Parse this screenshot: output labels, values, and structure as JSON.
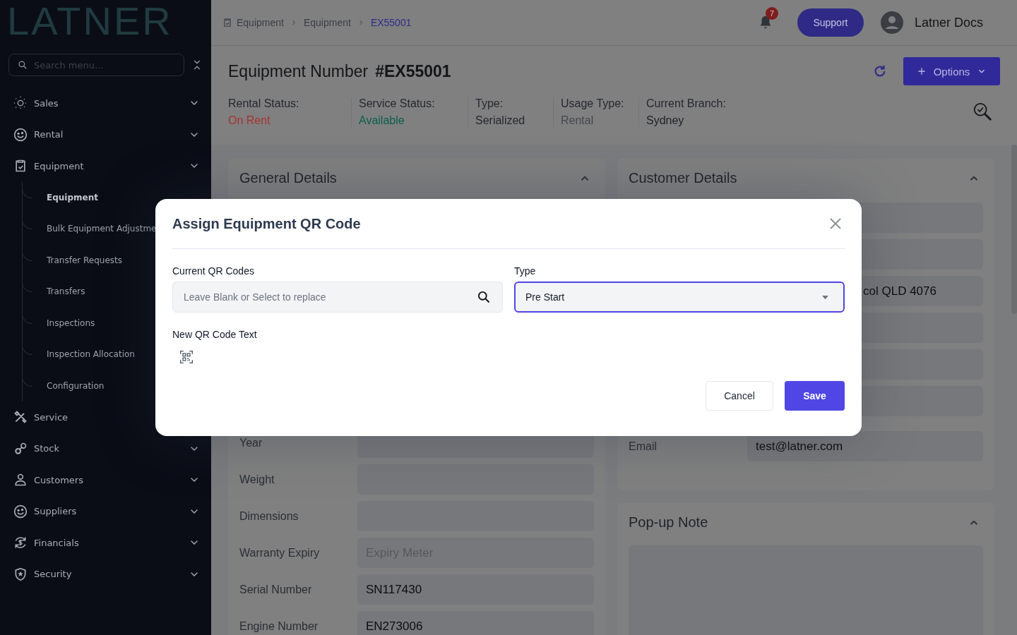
{
  "sidebar": {
    "logo": "LATNER",
    "search": {
      "placeholder": "Search menu..."
    },
    "items": [
      {
        "label": "Sales"
      },
      {
        "label": "Rental"
      },
      {
        "label": "Equipment",
        "children": [
          {
            "label": "Equipment",
            "selected": true
          },
          {
            "label": "Bulk Equipment Adjustme",
            "selected": false
          },
          {
            "label": "Transfer Requests",
            "selected": false
          },
          {
            "label": "Transfers",
            "selected": false
          },
          {
            "label": "Inspections",
            "selected": false
          },
          {
            "label": "Inspection Allocation",
            "selected": false
          },
          {
            "label": "Configuration",
            "selected": false
          }
        ]
      },
      {
        "label": "Service"
      },
      {
        "label": "Stock"
      },
      {
        "label": "Customers"
      },
      {
        "label": "Suppliers"
      },
      {
        "label": "Financials"
      },
      {
        "label": "Security"
      }
    ]
  },
  "topbar": {
    "breadcrumbs": [
      {
        "label": "Equipment",
        "current": false
      },
      {
        "label": "Equipment",
        "current": false
      },
      {
        "label": "EX55001",
        "current": true
      }
    ],
    "notifications": "7",
    "support": "Support",
    "user": "Latner Docs"
  },
  "header": {
    "title": "Equipment Number",
    "number": "#EX55001",
    "options": "Options",
    "fields": [
      {
        "label": "Rental Status:",
        "value": "On Rent",
        "color": "#a83232"
      },
      {
        "label": "Service Status:",
        "value": "Available",
        "color": "#0b5e4c"
      },
      {
        "label": "Type:",
        "value": "Serialized",
        "color": "#25282e"
      },
      {
        "label": "Usage Type:",
        "value": "Rental",
        "color": "#45484e"
      },
      {
        "label": "Current Branch:",
        "value": "Sydney",
        "color": "#1d2026"
      }
    ]
  },
  "general": {
    "title": "General Details",
    "rows": [
      {
        "label": "Year"
      },
      {
        "label": "Weight"
      },
      {
        "label": "Dimensions"
      },
      {
        "label": "Warranty Expiry",
        "placeholder": "Expiry Meter"
      },
      {
        "label": "Serial Number",
        "value": "SN117430"
      },
      {
        "label": "Engine Number",
        "value": "EN273006"
      }
    ]
  },
  "customer": {
    "title": "Customer Details",
    "rows": [
      {},
      {},
      {
        "value": "col QLD 4076"
      },
      {},
      {},
      {},
      {
        "label": "Email",
        "value": "test@latner.com"
      }
    ]
  },
  "popup_note": {
    "title": "Pop-up Note"
  },
  "dialog": {
    "title": "Assign Equipment QR Code",
    "fields": [
      {
        "label": "Current QR Codes",
        "kind": "search",
        "placeholder": "Leave Blank or Select to replace",
        "focused": false
      },
      {
        "label": "Type",
        "kind": "select",
        "value": "Pre Start",
        "focused": true
      }
    ],
    "new_code_label": "New QR Code Text",
    "cancel": "Cancel",
    "save": "Save"
  }
}
